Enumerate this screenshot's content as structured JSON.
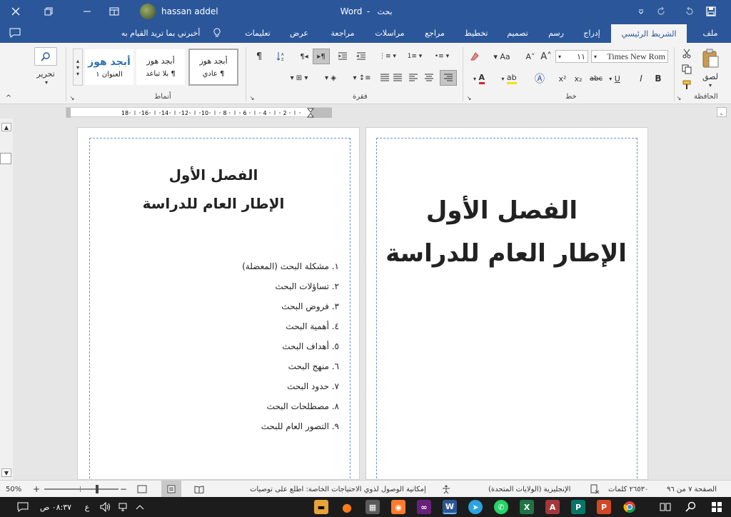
{
  "titlebar": {
    "search_label": "بحث",
    "app_label": "Word",
    "user_name": "hassan addel"
  },
  "ribbon_tabs": [
    "ملف",
    "الشريط الرئيسي",
    "إدراج",
    "رسم",
    "تصميم",
    "تخطيط",
    "مراجع",
    "مراسلات",
    "مراجعة",
    "عرض",
    "تعليمات"
  ],
  "tell_me": "أخبرني بما تريد القيام به",
  "groups": {
    "clipboard": "الحافظة",
    "paste": "لصق",
    "font": "خط",
    "paragraph": "فقرة",
    "styles": "أنماط",
    "editing": "تحرير"
  },
  "font_name": "Times New Rom",
  "font_size": "١١",
  "styles": [
    {
      "sample": "أبجد هوز",
      "name": "¶ عادي"
    },
    {
      "sample": "أبجد هوز",
      "name": "¶ بلا تباعد"
    },
    {
      "sample": "أبجد هوز",
      "name": "العنوان ١"
    }
  ],
  "ruler_ticks": [
    "2",
    "4",
    "6",
    "8",
    "10",
    "12",
    "14",
    "16",
    "18"
  ],
  "page_left": {
    "heading1": "الفصل الأول",
    "heading2": "الإطار العام للدراسة",
    "items": [
      "١. مشكلة البحث (المعضلة)",
      "٢. تساؤلات البحث",
      "٣. فروض البحث",
      "٤. أهمية البحث",
      "٥. أهداف البحث",
      "٦. منهج البحث",
      "٧. حدود البحث",
      "٨. مصطلحات البحث",
      "٩. التصور العام للبحث"
    ]
  },
  "page_right": {
    "heading1": "الفصل الأول",
    "heading2": "الإطار العام للدراسة"
  },
  "status": {
    "page": "الصفحة ٧ من ٩٦",
    "words": "٢٦٥٣٠ كلمات",
    "language": "الإنجليزية (الولايات المتحدة)",
    "accessibility": "إمكانية الوصول لذوي الاحتياجات الخاصة: اطلع على توصيات",
    "zoom": "50%"
  },
  "taskbar": {
    "time": "٠٨:٣٧ ص",
    "lang": "ع"
  },
  "colors": {
    "brand": "#2b579a",
    "taskbar": "#1c1c1c"
  }
}
